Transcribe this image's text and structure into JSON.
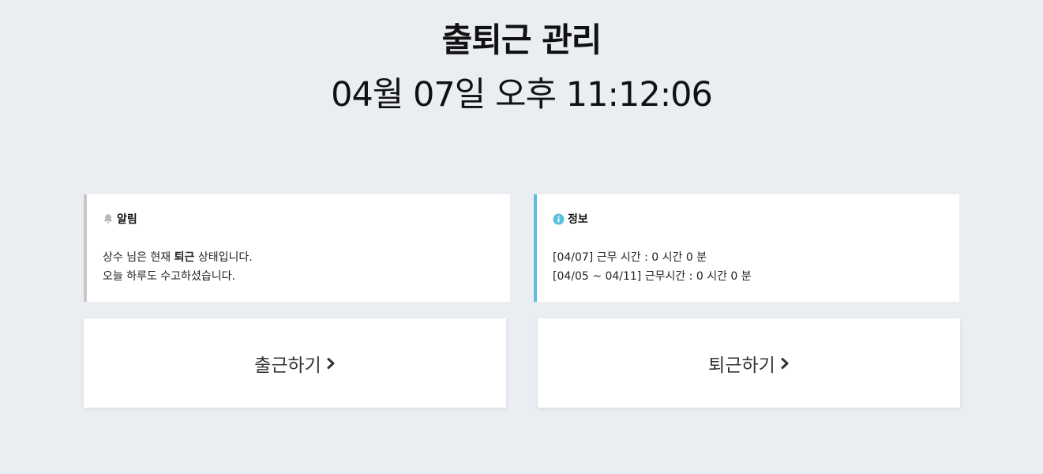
{
  "header": {
    "title": "출퇴근 관리",
    "clock": "04월 07일 오후 11:12:06"
  },
  "alert": {
    "icon": "bell-icon",
    "title": "알림",
    "line1_prefix": "상수 님은 현재 ",
    "line1_status": "퇴근",
    "line1_suffix": " 상태입니다.",
    "line2": "오늘 하루도 수고하셨습니다.",
    "border_color": "#c8c8c8"
  },
  "info": {
    "icon": "info-circle-icon",
    "title": "정보",
    "line1": "[04/07] 근무 시간 : 0 시간 0 분",
    "line2": "[04/05 ~ 04/11] 근무시간 : 0 시간 0 분",
    "accent_color": "#5bc0de"
  },
  "actions": {
    "clock_in_label": "출근하기",
    "clock_out_label": "퇴근하기",
    "chevron_icon": "chevron-right-icon"
  }
}
